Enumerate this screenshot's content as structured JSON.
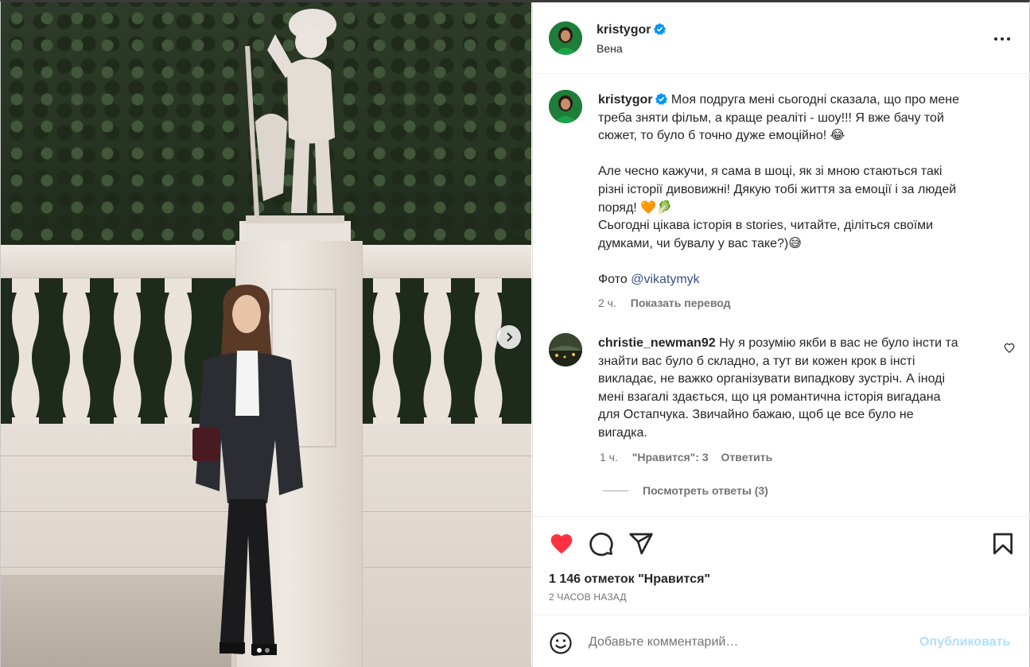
{
  "post": {
    "author": "kristygor",
    "location": "Вена",
    "caption": {
      "lines": [
        "Моя подруга мені сьогодні сказала, що про мене",
        "треба зняти фільм, а краще реаліті - шоу!!! Я вже бачу той",
        "сюжет, то було б точно дуже емоційно! 😂",
        "",
        "Але чесно кажучи, я сама в шоці, як зі мною стаються такі",
        "різні історії дивовижні! Дякую тобі життя за емоції і за людей",
        "поряд! 🧡🥬",
        "Сьогодні цікава історія в stories, читайте, діліться своїми",
        "думками, чи бувалу у вас таке?)😅",
        ""
      ],
      "photo_credit_prefix": "Фото ",
      "photo_credit_handle": "@vikatymyk",
      "time": "2 ч.",
      "translate_label": "Показать перевод"
    },
    "comment": {
      "author": "christie_newman92",
      "lines": [
        "Ну я розумію якби в вас не було інсти та",
        "знайти вас було б складно, а тут ви кожен крок в інсті",
        "викладає, не важко організувати випадкову зустріч. А іноді",
        "мені взагалі здається, що ця романтична історія вигадана",
        "для Остапчука. Звичайно бажаю, щоб це все було не",
        "вигадка."
      ],
      "time": "1 ч.",
      "likes": "\"Нравится\": 3",
      "reply_label": "Ответить",
      "view_replies": "Посмотреть ответы (3)"
    },
    "likes_text": "1 146 отметок \"Нравится\"",
    "time_ago": "2 ЧАСОВ НАЗАД",
    "add_comment_placeholder": "Добавьте комментарий…",
    "publish_label": "Опубликовать"
  },
  "icons": {
    "verified": "verified-badge-icon",
    "more": "more-options-icon",
    "like": "heart-filled-icon",
    "comment": "comment-bubble-icon",
    "share": "paper-plane-icon",
    "save": "bookmark-icon",
    "emoji": "emoji-smile-icon",
    "next": "chevron-right-icon"
  },
  "colors": {
    "like_red": "#ff3040",
    "verified_blue": "#0095f6",
    "link": "#385185",
    "publish_disabled": "#b2dffc"
  },
  "carousel": {
    "slides": 2,
    "current": 1
  }
}
